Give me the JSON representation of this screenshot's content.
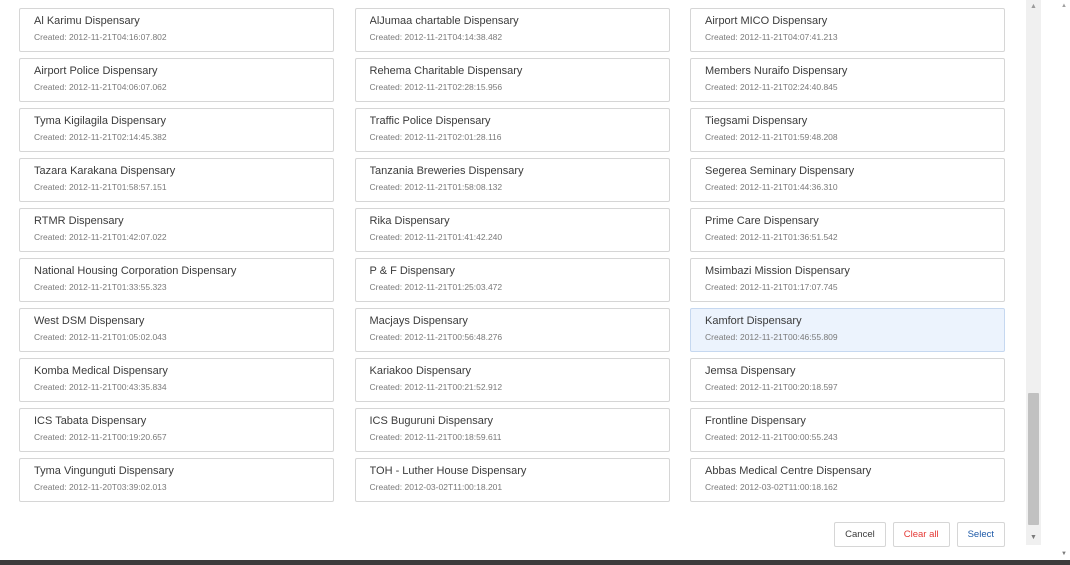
{
  "dispensaries": [
    {
      "name": "Al Karimu Dispensary",
      "created": "Created: 2012-11-21T04:16:07.802"
    },
    {
      "name": "AlJumaa chartable Dispensary",
      "created": "Created: 2012-11-21T04:14:38.482"
    },
    {
      "name": "Airport MICO Dispensary",
      "created": "Created: 2012-11-21T04:07:41.213"
    },
    {
      "name": "Airport Police Dispensary",
      "created": "Created: 2012-11-21T04:06:07.062"
    },
    {
      "name": "Rehema Charitable Dispensary",
      "created": "Created: 2012-11-21T02:28:15.956"
    },
    {
      "name": "Members Nuraifo Dispensary",
      "created": "Created: 2012-11-21T02:24:40.845"
    },
    {
      "name": "Tyma Kigilagila Dispensary",
      "created": "Created: 2012-11-21T02:14:45.382"
    },
    {
      "name": "Traffic Police Dispensary",
      "created": "Created: 2012-11-21T02:01:28.116"
    },
    {
      "name": "Tiegsami Dispensary",
      "created": "Created: 2012-11-21T01:59:48.208"
    },
    {
      "name": "Tazara Karakana Dispensary",
      "created": "Created: 2012-11-21T01:58:57.151"
    },
    {
      "name": "Tanzania Breweries Dispensary",
      "created": "Created: 2012-11-21T01:58:08.132"
    },
    {
      "name": "Segerea Seminary Dispensary",
      "created": "Created: 2012-11-21T01:44:36.310"
    },
    {
      "name": "RTMR Dispensary",
      "created": "Created: 2012-11-21T01:42:07.022"
    },
    {
      "name": "Rika Dispensary",
      "created": "Created: 2012-11-21T01:41:42.240"
    },
    {
      "name": "Prime Care Dispensary",
      "created": "Created: 2012-11-21T01:36:51.542"
    },
    {
      "name": "National Housing Corporation Dispensary",
      "created": "Created: 2012-11-21T01:33:55.323"
    },
    {
      "name": "P & F Dispensary",
      "created": "Created: 2012-11-21T01:25:03.472"
    },
    {
      "name": "Msimbazi Mission Dispensary",
      "created": "Created: 2012-11-21T01:17:07.745"
    },
    {
      "name": "West DSM Dispensary",
      "created": "Created: 2012-11-21T01:05:02.043"
    },
    {
      "name": "Macjays Dispensary",
      "created": "Created: 2012-11-21T00:56:48.276"
    },
    {
      "name": "Kamfort Dispensary",
      "created": "Created: 2012-11-21T00:46:55.809",
      "selected": true
    },
    {
      "name": "Komba Medical Dispensary",
      "created": "Created: 2012-11-21T00:43:35.834"
    },
    {
      "name": "Kariakoo Dispensary",
      "created": "Created: 2012-11-21T00:21:52.912"
    },
    {
      "name": "Jemsa Dispensary",
      "created": "Created: 2012-11-21T00:20:18.597"
    },
    {
      "name": "ICS Tabata Dispensary",
      "created": "Created: 2012-11-21T00:19:20.657"
    },
    {
      "name": "ICS Buguruni Dispensary",
      "created": "Created: 2012-11-21T00:18:59.611"
    },
    {
      "name": "Frontline Dispensary",
      "created": "Created: 2012-11-21T00:00:55.243"
    },
    {
      "name": "Tyma Vingunguti Dispensary",
      "created": "Created: 2012-11-20T03:39:02.013"
    },
    {
      "name": "TOH - Luther House Dispensary",
      "created": "Created: 2012-03-02T11:00:18.201"
    },
    {
      "name": "Abbas Medical Centre Dispensary",
      "created": "Created: 2012-03-02T11:00:18.162"
    }
  ],
  "footer": {
    "cancel_label": "Cancel",
    "clear_label": "Clear all",
    "select_label": "Select"
  },
  "colors": {
    "selected_background": "#ecf3fd",
    "clear_text": "#e53935",
    "select_text": "#1e5aa8"
  },
  "icons": {
    "scroll_up": "caret-up-icon",
    "scroll_down": "caret-down-icon"
  }
}
